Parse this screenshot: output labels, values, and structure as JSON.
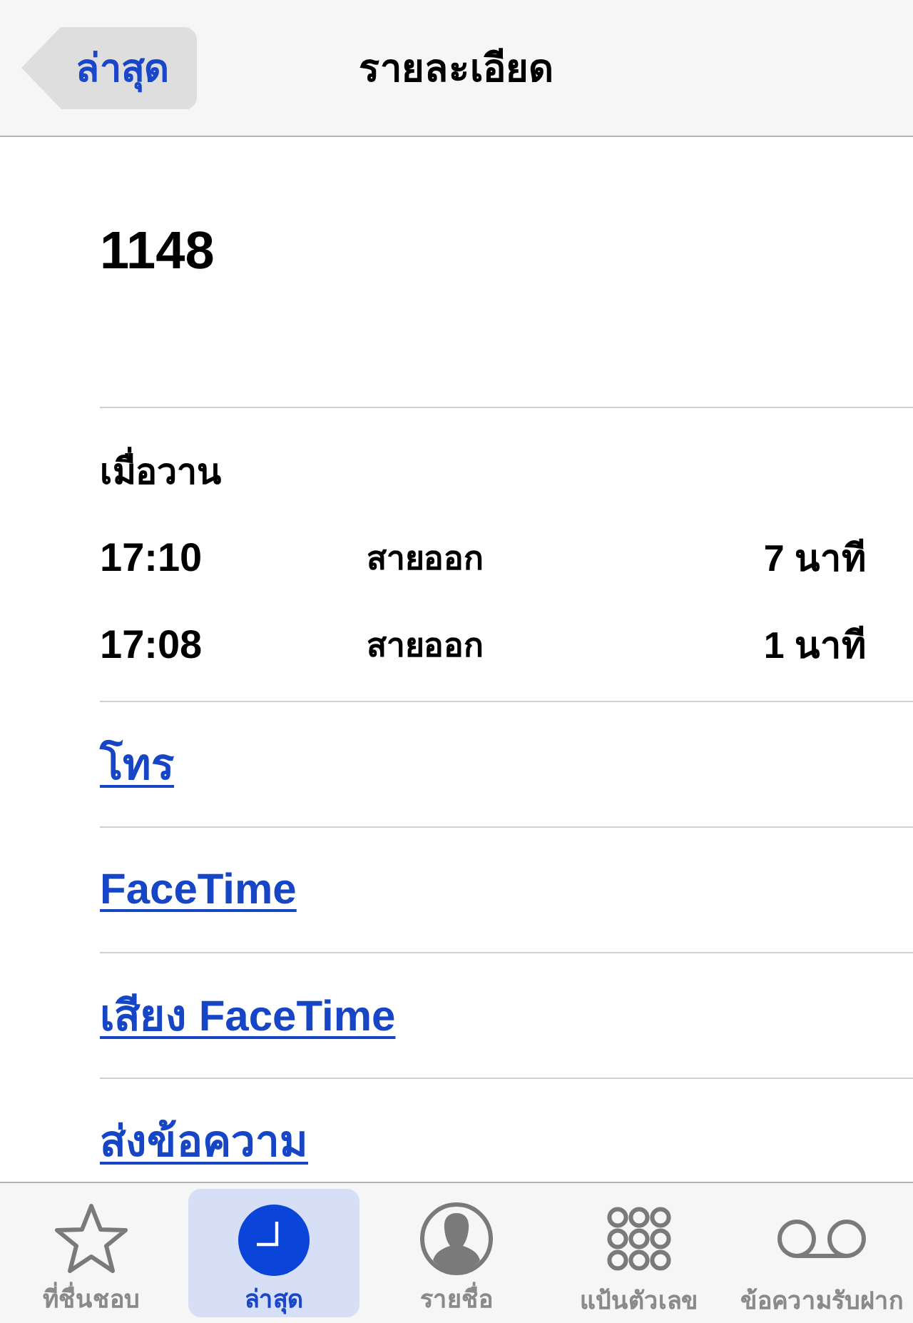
{
  "nav_bar": {
    "back_button": "ล่าสุด",
    "title": "รายละเอียด"
  },
  "contact": {
    "number": "1148"
  },
  "call_history": {
    "date": "เมื่อวาน",
    "calls": [
      {
        "time": "17:10",
        "type": "สายออก",
        "duration": "7 นาที"
      },
      {
        "time": "17:08",
        "type": "สายออก",
        "duration": "1 นาที"
      }
    ]
  },
  "actions": [
    {
      "label": "โทร"
    },
    {
      "label": "FaceTime"
    },
    {
      "label": "เสียง FaceTime"
    },
    {
      "label": "ส่งข้อความ"
    }
  ],
  "tab_bar": {
    "tabs": [
      {
        "label": "ที่ชื่นชอบ",
        "kind": "star",
        "selected": false
      },
      {
        "label": "ล่าสุด",
        "kind": "clock",
        "selected": true
      },
      {
        "label": "รายชื่อ",
        "kind": "person",
        "selected": false
      },
      {
        "label": "แป้นตัวเลข",
        "kind": "keypad",
        "selected": false
      },
      {
        "label": "ข้อความรับฝาก",
        "kind": "voicemail",
        "selected": false
      }
    ]
  }
}
